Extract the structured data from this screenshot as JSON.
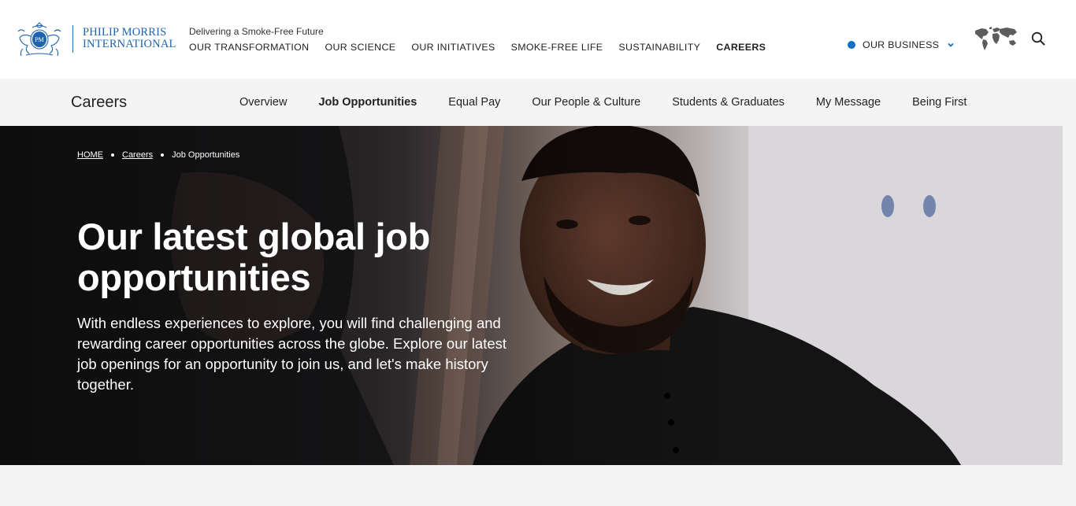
{
  "brand": {
    "logo_lines": [
      "PHILIP MORRIS",
      "INTERNATIONAL"
    ],
    "crest_monogram": "PM",
    "tagline": "Delivering a Smoke-Free Future",
    "accent_color": "#1f63ae"
  },
  "main_nav": {
    "items": [
      {
        "label": "OUR TRANSFORMATION"
      },
      {
        "label": "OUR SCIENCE"
      },
      {
        "label": "OUR INITIATIVES"
      },
      {
        "label": "SMOKE-FREE LIFE"
      },
      {
        "label": "SUSTAINABILITY"
      },
      {
        "label": "CAREERS",
        "active": true
      }
    ]
  },
  "business_selector": {
    "label": "OUR BUSINESS",
    "dot_color": "#0e71c3",
    "icon": "chevron-down-icon"
  },
  "utility_icons": [
    "world-map-icon",
    "search-icon"
  ],
  "sub_nav": {
    "title": "Careers",
    "items": [
      {
        "label": "Overview"
      },
      {
        "label": "Job Opportunities",
        "active": true
      },
      {
        "label": "Equal Pay"
      },
      {
        "label": "Our People & Culture"
      },
      {
        "label": "Students & Graduates"
      },
      {
        "label": "My Message"
      },
      {
        "label": "Being First"
      }
    ]
  },
  "breadcrumb": {
    "items": [
      "HOME",
      "Careers",
      "Job Opportunities"
    ]
  },
  "hero": {
    "title": "Our latest global job opportunities",
    "description": "With endless experiences to explore, you will find challenging and rewarding career opportunities across the globe. Explore our latest job openings for an opportunity to join us, and let's make history together."
  }
}
